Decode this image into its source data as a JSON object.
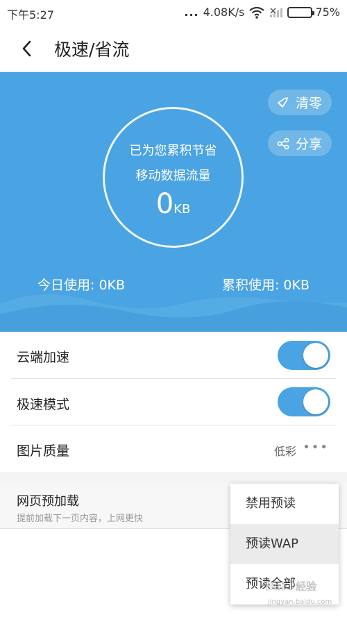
{
  "status_bar": {
    "time": "下午5:27",
    "dots": "...",
    "network_speed": "4.08K/s",
    "battery_percent": "75%",
    "battery_level": 0.75
  },
  "header": {
    "title": "极速/省流"
  },
  "hero": {
    "line1": "已为您累积节省",
    "line2": "移动数据流量",
    "saved_value": "0",
    "saved_unit": "KB",
    "clear_label": "清零",
    "share_label": "分享",
    "today_usage": "今日使用: 0KB",
    "total_usage": "累积使用: 0KB",
    "accent_color": "#4aa3e2"
  },
  "settings": {
    "cloud_accel": {
      "label": "云端加速",
      "enabled": true
    },
    "speed_mode": {
      "label": "极速模式",
      "enabled": true
    },
    "image_quality": {
      "label": "图片质量",
      "value": "低彩"
    },
    "preload": {
      "label": "网页预加载",
      "description": "提前加载下一页内容，上网更快"
    }
  },
  "dropdown": {
    "options": [
      "禁用预读",
      "预读WAP",
      "预读全部"
    ],
    "highlighted": "预读WAP"
  }
}
